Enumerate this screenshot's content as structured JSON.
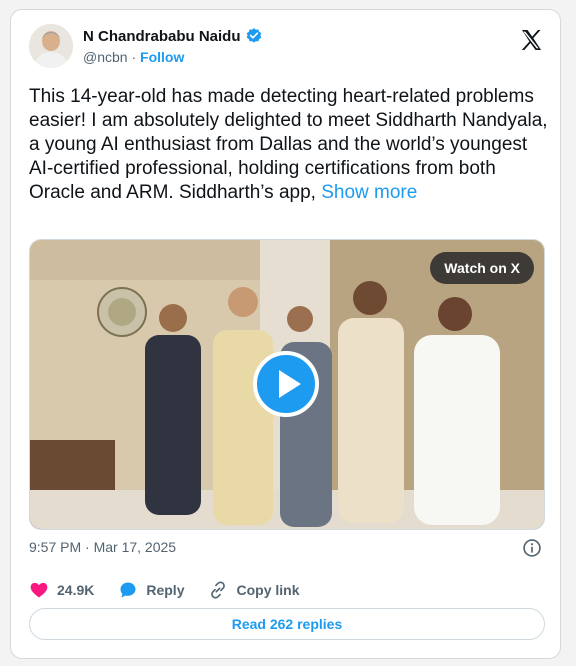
{
  "author": {
    "name": "N Chandrababu Naidu",
    "handle": "@ncbn",
    "separator": "·",
    "follow_label": "Follow"
  },
  "tweet": {
    "text": "This 14-year-old has made detecting heart-related problems easier! I am absolutely delighted to meet Siddharth Nandyala, a young AI enthusiast from Dallas and the world’s youngest AI-certified professional, holding certifications from both Oracle and ARM. Siddharth’s app,",
    "show_more": "Show more"
  },
  "media": {
    "watch_label": "Watch on X"
  },
  "meta": {
    "timestamp": "9:57 PM · Mar 17, 2025"
  },
  "actions": {
    "likes": "24.9K",
    "reply_label": "Reply",
    "copy_label": "Copy link"
  },
  "footer": {
    "read_replies": "Read 262 replies"
  },
  "colors": {
    "accent": "#1d9bf0",
    "like": "#f91880"
  }
}
